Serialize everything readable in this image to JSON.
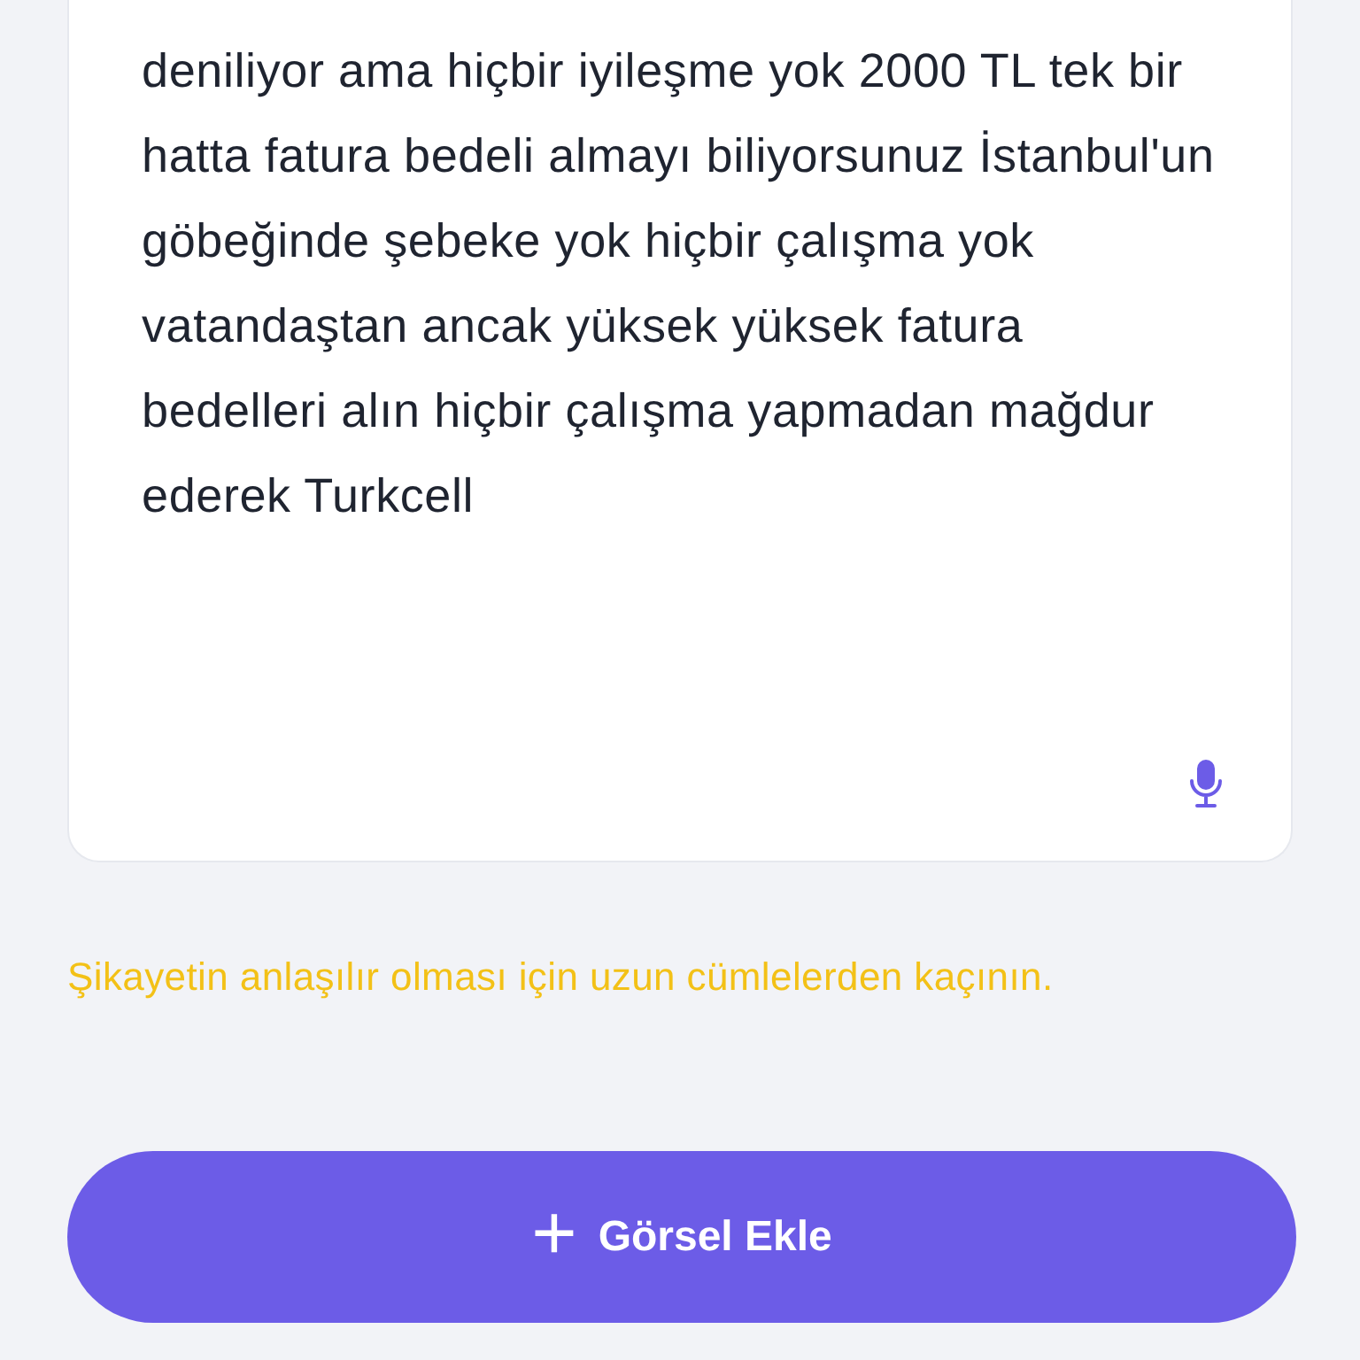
{
  "complaint": {
    "text": "deniliyor ama hiçbir iyileşme yok 2000 TL tek bir hatta fatura bedeli almayı biliyorsunuz İstanbul'un göbeğinde şebeke yok hiçbir çalışma yok vatandaştan ancak yüksek yüksek fatura bedelleri alın hiçbir çalışma yapmadan mağdur ederek Turkcell"
  },
  "hint": "Şikayetin anlaşılır olması için uzun cümlelerden kaçının.",
  "add_image_button": {
    "icon": "+",
    "label": "Görsel Ekle"
  }
}
